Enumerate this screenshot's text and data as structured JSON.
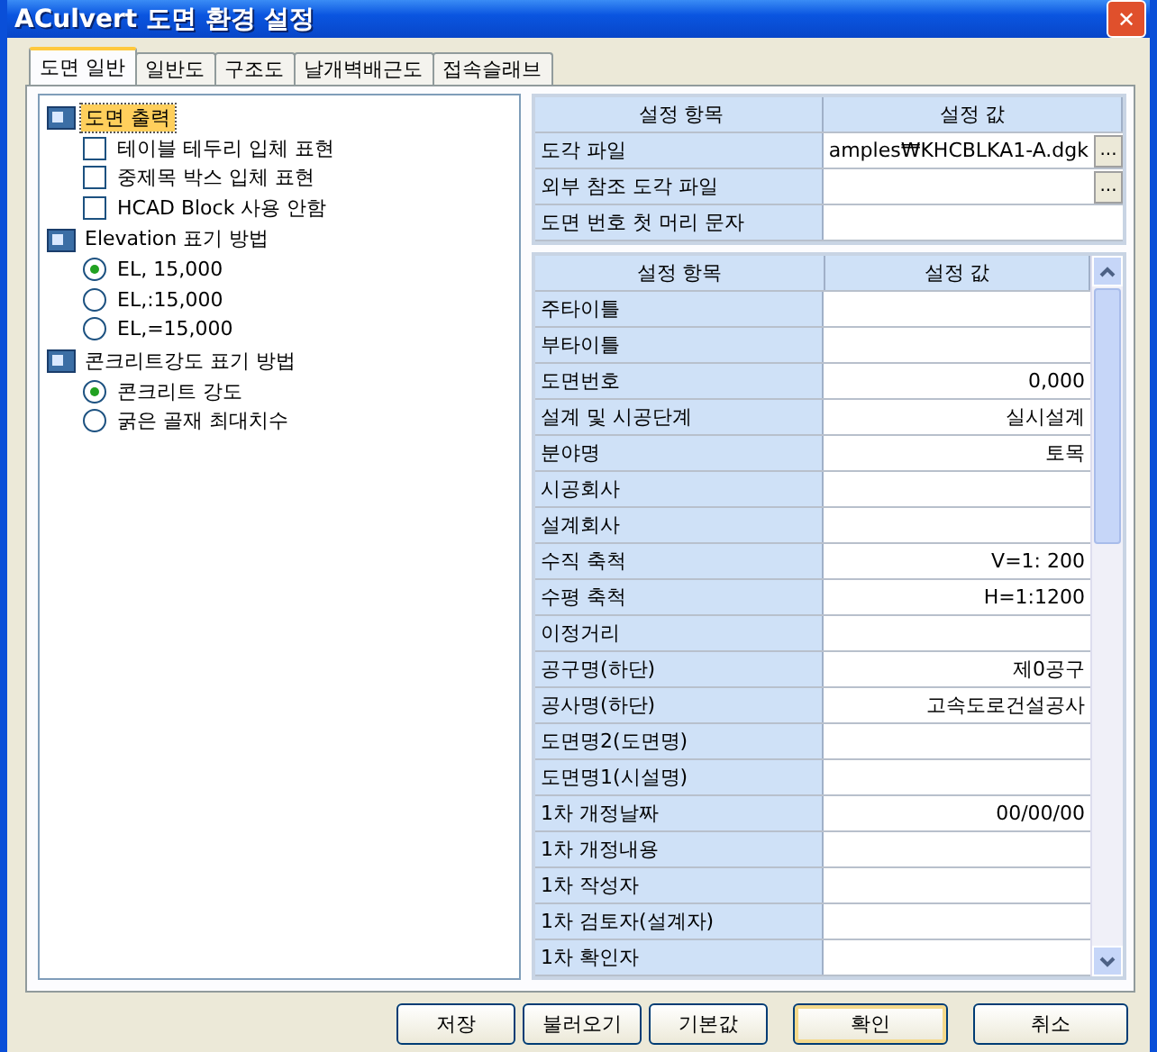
{
  "window": {
    "title": "ACulvert 도면 환경 설정",
    "close": "✕"
  },
  "tabs": [
    {
      "label": "도면 일반",
      "selected": true
    },
    {
      "label": "일반도",
      "selected": false
    },
    {
      "label": "구조도",
      "selected": false
    },
    {
      "label": "날개벽배근도",
      "selected": false
    },
    {
      "label": "접속슬래브",
      "selected": false
    }
  ],
  "tree": [
    {
      "label": "도면 출력",
      "selected": true,
      "children": [
        {
          "kind": "checkbox",
          "label": "테이블 테두리 입체 표현",
          "checked": false
        },
        {
          "kind": "checkbox",
          "label": "중제목 박스 입체 표현",
          "checked": false
        },
        {
          "kind": "checkbox",
          "label": "HCAD Block 사용 안함",
          "checked": false
        }
      ]
    },
    {
      "label": "Elevation 표기 방법",
      "selected": false,
      "children": [
        {
          "kind": "radio",
          "label": "EL, 15,000",
          "selected": true
        },
        {
          "kind": "radio",
          "label": "EL,:15,000",
          "selected": false
        },
        {
          "kind": "radio",
          "label": "EL,=15,000",
          "selected": false
        }
      ]
    },
    {
      "label": "콘크리트강도 표기 방법",
      "selected": false,
      "children": [
        {
          "kind": "radio",
          "label": "콘크리트 강도",
          "selected": true
        },
        {
          "kind": "radio",
          "label": "굵은 골재 최대치수",
          "selected": false
        }
      ]
    }
  ],
  "file_table": {
    "columns": [
      "설정 항목",
      "설정 값"
    ],
    "rows": [
      {
        "item": "도각 파일",
        "value": "amples₩KHCBLKA1-A.dgk",
        "button": "..."
      },
      {
        "item": "외부 참조 도각 파일",
        "button": "..."
      },
      {
        "item": "도면 번호 첫 머리 문자"
      }
    ]
  },
  "property_table": {
    "columns": [
      "설정 항목",
      "설정 값"
    ],
    "rows": [
      {
        "item": "주타이틀"
      },
      {
        "item": "부타이틀"
      },
      {
        "item": "도면번호",
        "value": "0,000"
      },
      {
        "item": "설계 및 시공단계",
        "value": "실시설계"
      },
      {
        "item": "분야명",
        "value": "토목"
      },
      {
        "item": "시공회사"
      },
      {
        "item": "설계회사"
      },
      {
        "item": "수직 축척",
        "value": "V=1: 200"
      },
      {
        "item": "수평 축척",
        "value": "H=1:1200"
      },
      {
        "item": "이정거리"
      },
      {
        "item": "공구명(하단)",
        "value": "제0공구"
      },
      {
        "item": "공사명(하단)",
        "value": "고속도로건설공사"
      },
      {
        "item": "도면명2(도면명)"
      },
      {
        "item": "도면명1(시설명)"
      },
      {
        "item": "1차 개정날짜",
        "value": "00/00/00"
      },
      {
        "item": "1차 개정내용"
      },
      {
        "item": "1차 작성자"
      },
      {
        "item": "1차 검토자(설계자)"
      },
      {
        "item": "1차 확인자"
      }
    ]
  },
  "buttons": [
    {
      "label": "저장",
      "default": false,
      "wide": false
    },
    {
      "label": "불러오기",
      "default": false,
      "wide": false
    },
    {
      "label": "기본값",
      "default": false,
      "wide": false
    },
    {
      "label": "확인",
      "default": true,
      "wide": true
    },
    {
      "label": "취소",
      "default": false,
      "wide": true
    }
  ]
}
